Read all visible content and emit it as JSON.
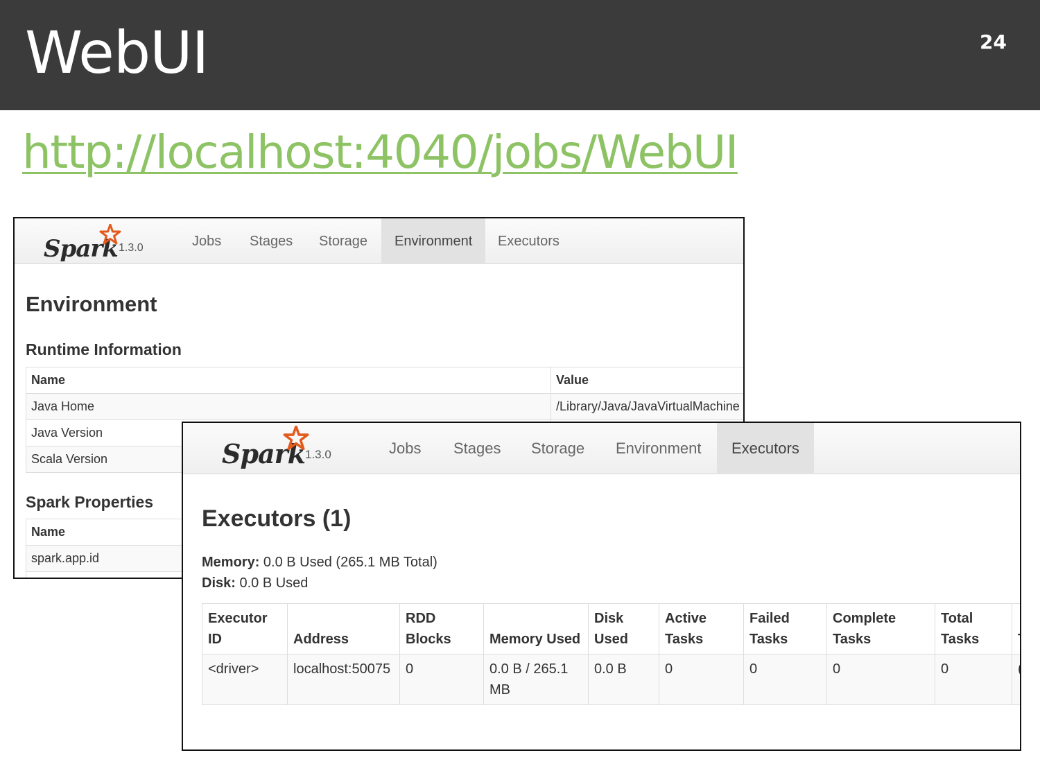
{
  "slide": {
    "title": "WebUI",
    "page_number": "24",
    "link": "http://localhost:4040/jobs/WebUI"
  },
  "colors": {
    "header_bg": "#3b3b3b",
    "link": "#8dc364",
    "spark_star": "#e25a1c",
    "active_tab_bg": "#e2e2e2"
  },
  "environment_window": {
    "logo": {
      "word": "Spark",
      "version": "1.3.0",
      "icon": "spark-star-icon"
    },
    "tabs": [
      {
        "label": "Jobs",
        "active": false
      },
      {
        "label": "Stages",
        "active": false
      },
      {
        "label": "Storage",
        "active": false
      },
      {
        "label": "Environment",
        "active": true
      },
      {
        "label": "Executors",
        "active": false
      }
    ],
    "title": "Environment",
    "runtime": {
      "heading": "Runtime Information",
      "columns": [
        "Name",
        "Value"
      ],
      "rows": [
        [
          "Java Home",
          "/Library/Java/JavaVirtualMachine"
        ],
        [
          "Java Version",
          ""
        ],
        [
          "Scala Version",
          ""
        ]
      ]
    },
    "properties": {
      "heading": "Spark Properties",
      "columns": [
        "Name"
      ],
      "rows": [
        [
          "spark.app.id"
        ]
      ]
    }
  },
  "executors_window": {
    "logo": {
      "word": "Spark",
      "version": "1.3.0",
      "icon": "spark-star-icon"
    },
    "tabs": [
      {
        "label": "Jobs",
        "active": false
      },
      {
        "label": "Stages",
        "active": false
      },
      {
        "label": "Storage",
        "active": false
      },
      {
        "label": "Environment",
        "active": false
      },
      {
        "label": "Executors",
        "active": true
      }
    ],
    "title": "Executors (1)",
    "memory_label": "Memory:",
    "memory_value": "0.0 B Used (265.1 MB Total)",
    "disk_label": "Disk:",
    "disk_value": "0.0 B Used",
    "table": {
      "columns": [
        "Executor ID",
        "Address",
        "RDD Blocks",
        "Memory Used",
        "Disk Used",
        "Active Tasks",
        "Failed Tasks",
        "Complete Tasks",
        "Total Tasks",
        "T T"
      ],
      "rows": [
        [
          "<driver>",
          "localhost:50075",
          "0",
          "0.0 B / 265.1 MB",
          "0.0 B",
          "0",
          "0",
          "0",
          "0",
          "("
        ]
      ]
    }
  }
}
